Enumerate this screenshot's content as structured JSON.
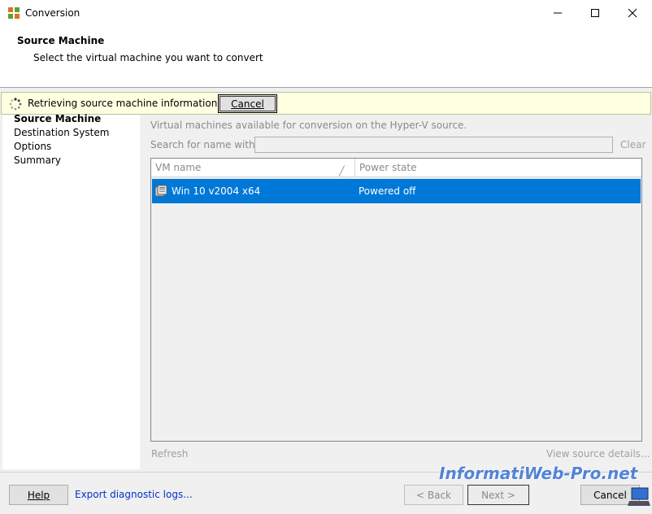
{
  "window": {
    "title": "Conversion"
  },
  "header": {
    "title": "Source Machine",
    "subtitle": "Select the virtual machine you want to convert"
  },
  "infobar": {
    "message": "Retrieving source machine information...",
    "cancel_label": "Cancel"
  },
  "sidebar": {
    "items": [
      {
        "label": "Source Machine",
        "active": true
      },
      {
        "label": "Destination System",
        "active": false
      },
      {
        "label": "Options",
        "active": false
      },
      {
        "label": "Summary",
        "active": false
      }
    ]
  },
  "main": {
    "available_label": "Virtual machines available for conversion on the Hyper-V source.",
    "search_label": "Search for name with:",
    "search_value": "",
    "clear_label": "Clear",
    "columns": [
      "VM name",
      "Power state"
    ],
    "rows": [
      {
        "name": "Win 10 v2004 x64",
        "state": "Powered off",
        "selected": true
      }
    ],
    "refresh_label": "Refresh",
    "view_details_label": "View source details..."
  },
  "footer": {
    "help_label": "Help",
    "export_label": "Export diagnostic logs...",
    "back_label": "< Back",
    "next_label": "Next >",
    "cancel_label": "Cancel"
  },
  "watermark": {
    "text": "InformatiWeb-Pro.net"
  },
  "colors": {
    "selection": "#0078d7",
    "infobar_bg": "#ffffe1",
    "link": "#0033cc"
  }
}
